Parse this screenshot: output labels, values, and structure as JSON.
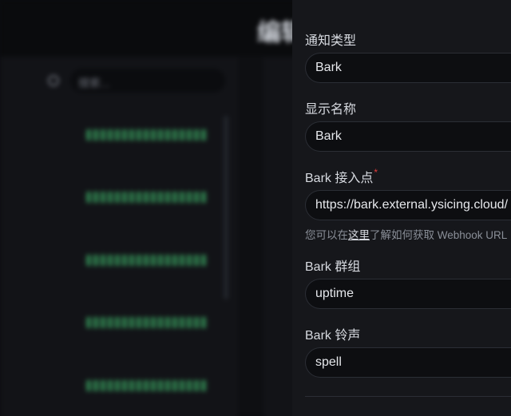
{
  "background": {
    "page_title": "编辑",
    "search_placeholder": "搜索..."
  },
  "drawer": {
    "notification_type": {
      "label": "通知类型",
      "value": "Bark"
    },
    "display_name": {
      "label": "显示名称",
      "value": "Bark"
    },
    "endpoint": {
      "label": "Bark 接入点",
      "required_mark": "*",
      "value": "https://bark.external.ysicing.cloud/",
      "hint_prefix": "您可以在",
      "hint_link": "这里",
      "hint_suffix": "了解如何获取 Webhook URL"
    },
    "group": {
      "label": "Bark 群组",
      "value": "uptime"
    },
    "sound": {
      "label": "Bark 铃声",
      "value": "spell"
    }
  },
  "colors": {
    "drawer_bg": "#16171b",
    "input_bg": "#0d0e11",
    "required": "#e03b3b",
    "beat_up": "#2f7d4d"
  }
}
